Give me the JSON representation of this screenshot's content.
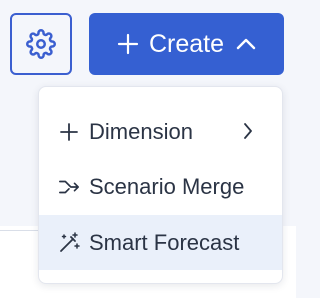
{
  "toolbar": {
    "settings_icon": "gear-icon",
    "create_label": "Create",
    "create_icon": "plus-icon",
    "create_chevron": "chevron-up-icon",
    "accent": "#3560d2"
  },
  "menu": {
    "items": [
      {
        "label": "Dimension",
        "icon": "plus-icon",
        "submenu": true
      },
      {
        "label": "Scenario Merge",
        "icon": "merge-arrow-icon",
        "submenu": false
      },
      {
        "label": "Smart Forecast",
        "icon": "magic-wand-icon",
        "submenu": false,
        "highlighted": true
      }
    ]
  }
}
